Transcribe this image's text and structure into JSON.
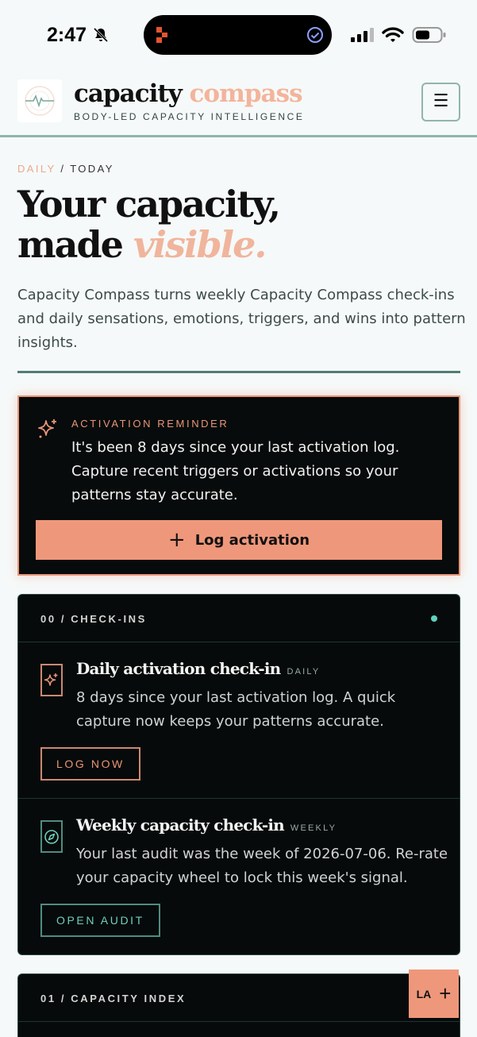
{
  "status_bar": {
    "time": "2:47",
    "icons": [
      "bell-muted-icon",
      "app-icon",
      "checkmark-icon",
      "signal-icon",
      "wifi-icon",
      "battery-icon"
    ]
  },
  "header": {
    "brand_main": "capacity",
    "brand_accent": "compass",
    "tagline": "BODY-LED CAPACITY INTELLIGENCE",
    "menu_icon": "☰"
  },
  "breadcrumb": {
    "section": "DAILY",
    "separator": "/",
    "page": "TODAY"
  },
  "hero": {
    "line1": "Your capacity,",
    "line2_plain": "made",
    "line2_accent": "visible."
  },
  "intro": "Capacity Compass turns weekly Capacity Compass check-ins and daily sensations, emotions, triggers, and wins into pattern insights.",
  "reminder": {
    "kicker": "ACTIVATION REMINDER",
    "body": "It's been 8 days since your last activation log. Capture recent triggers or activations so your patterns stay accurate.",
    "button_icon": "+",
    "button_label": "Log activation"
  },
  "checkins": {
    "title": "00 / CHECK-INS",
    "items": [
      {
        "title": "Daily activation check-in",
        "tag": "DAILY",
        "body": "8 days since your last activation log. A quick capture now keeps your patterns accurate.",
        "button": "LOG NOW"
      },
      {
        "title": "Weekly capacity check-in",
        "tag": "WEEKLY",
        "body": "Your last audit was the week of 2026-07-06. Re-rate your capacity wheel to lock this week's signal.",
        "button": "OPEN AUDIT"
      }
    ]
  },
  "capacity_index": {
    "title": "01 / CAPACITY INDEX"
  },
  "fab": {
    "label": "LA",
    "icon": "+"
  },
  "colors": {
    "accent": "#ef977b",
    "teal": "#4f8c82",
    "dark_card": "#070a0a",
    "status_dot": "#5fd1bd"
  }
}
